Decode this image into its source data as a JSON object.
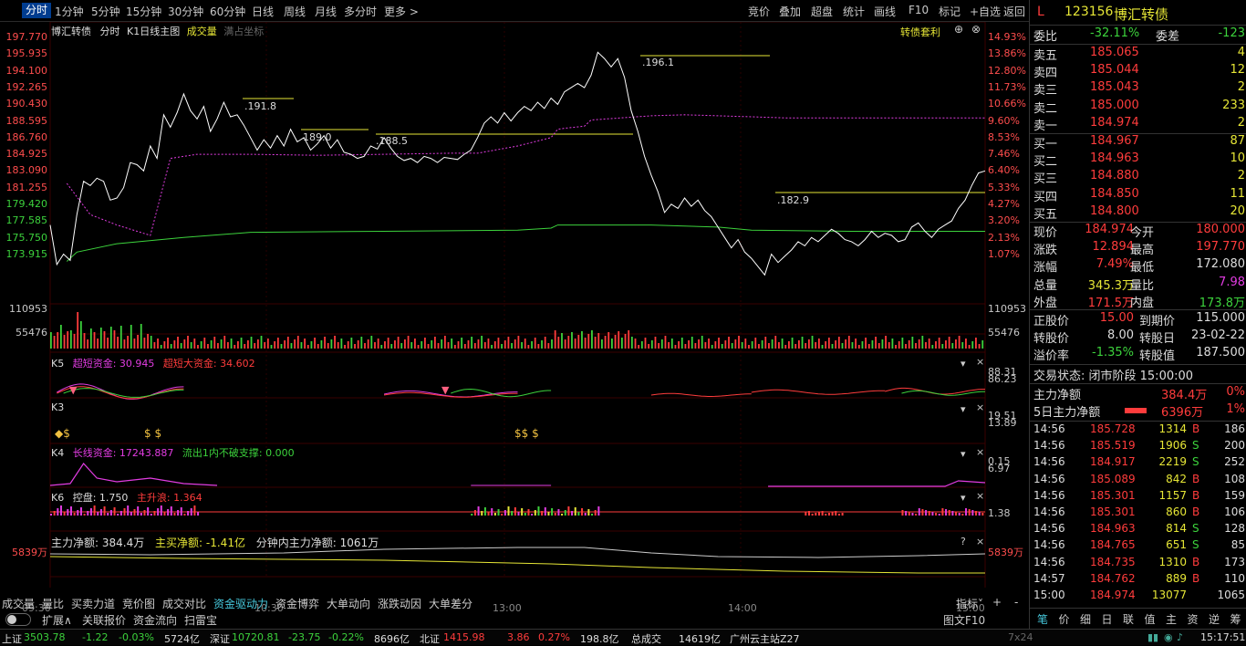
{
  "toolbar": {
    "tabs": [
      "分时",
      "1分钟",
      "5分钟",
      "15分钟",
      "30分钟",
      "60分钟",
      "日线",
      "周线",
      "月线",
      "多分时",
      "更多 >"
    ],
    "right": [
      "竞价",
      "叠加",
      "超盘",
      "统计",
      "画线",
      "F10",
      "标记",
      "+自选",
      "返回"
    ]
  },
  "chart_header": {
    "name": "博汇转债",
    "mode": "分时",
    "k1": "K1日线主图",
    "vol": "成交量",
    "full": "满占坐标",
    "tag": "转债套利"
  },
  "price_axis": [
    "197.770",
    "195.935",
    "194.100",
    "192.265",
    "190.430",
    "188.595",
    "186.760",
    "184.925",
    "183.090",
    "181.255",
    "179.420",
    "177.585",
    "175.750",
    "173.915"
  ],
  "pct_axis": [
    "14.93%",
    "13.86%",
    "12.80%",
    "11.73%",
    "10.66%",
    "9.60%",
    "8.53%",
    "7.46%",
    "6.40%",
    "5.33%",
    "4.27%",
    "3.20%",
    "2.13%",
    "1.07%"
  ],
  "vol_axis": [
    "110953",
    "55476"
  ],
  "annotations": [
    ".191.8",
    "189.0",
    ".188.5",
    ".196.1",
    ".182.9"
  ],
  "k5": {
    "label": "K5",
    "a": "超短资金: 30.945",
    "b": "超短大资金: 34.602",
    "r1": "88.31",
    "r2": "86.23"
  },
  "k3": {
    "label": "K3",
    "r1": "19.51",
    "r2": "13.89"
  },
  "k4": {
    "label": "K4",
    "a": "长线资金: 17243.887",
    "b": "流出1内不破支撑: 0.000",
    "r1": "0.15",
    "r2": "6.97"
  },
  "k6": {
    "label": "K6",
    "a": "控盘: 1.750",
    "b": "主升浪: 1.364",
    "r1": "1.38"
  },
  "flow": {
    "a": "主力净额: 384.4万",
    "b": "主买净额: -1.41亿",
    "c": "分钟内主力净额: 1061万",
    "axis": "5839万"
  },
  "time_axis": [
    "09:30",
    "10:30",
    "13:00",
    "14:00",
    "15:00"
  ],
  "bottom_tabs": [
    "成交量",
    "量比",
    "买卖力道",
    "竞价图",
    "成交对比",
    "资金驱动力",
    "资金博弈",
    "大单动向",
    "涨跌动因",
    "大单差分",
    "扩展∧",
    "关联报价",
    "资金流向",
    "扫雷宝"
  ],
  "bottom_right": {
    "ind": "指标˅",
    "plus": "+",
    "minus": "-",
    "f10": "图文F10"
  },
  "status": {
    "sh_name": "上证",
    "sh_val": "3503.78",
    "sh_chg": "-1.22",
    "sh_pct": "-0.03%",
    "sh_amt": "5724亿",
    "sz_name": "深证",
    "sz_val": "10720.81",
    "sz_chg": "-23.75",
    "sz_pct": "-0.22%",
    "sz_amt": "8696亿",
    "bz_name": "北证",
    "bz_val": "1415.98",
    "bz_chg": "3.86",
    "bz_pct": "0.27%",
    "bz_amt": "198.8亿",
    "tot_name": "总成交",
    "tot_amt": "14619亿",
    "station": "广州云主站Z27",
    "size": "7x24",
    "time": "15:17:51"
  },
  "quote": {
    "flag": "L",
    "code": "123156",
    "name": "博汇转债",
    "wb_label": "委比",
    "wb": "-32.11%",
    "wc_label": "委差",
    "wc": "-123",
    "asks": [
      [
        "卖五",
        "185.065",
        "4"
      ],
      [
        "卖四",
        "185.044",
        "12"
      ],
      [
        "卖三",
        "185.043",
        "2"
      ],
      [
        "卖二",
        "185.000",
        "233"
      ],
      [
        "卖一",
        "184.974",
        "2"
      ]
    ],
    "bids": [
      [
        "买一",
        "184.967",
        "87"
      ],
      [
        "买二",
        "184.963",
        "10"
      ],
      [
        "买三",
        "184.880",
        "2"
      ],
      [
        "买四",
        "184.850",
        "11"
      ],
      [
        "买五",
        "184.800",
        "20"
      ]
    ],
    "stats": [
      [
        "现价",
        "184.974",
        "今开",
        "180.000"
      ],
      [
        "涨跌",
        "12.894",
        "最高",
        "197.770"
      ],
      [
        "涨幅",
        "7.49%",
        "最低",
        "172.080"
      ],
      [
        "总量",
        "345.3万",
        "量比",
        "7.98"
      ],
      [
        "外盘",
        "171.5万",
        "内盘",
        "173.8万"
      ]
    ],
    "extra": [
      [
        "正股价",
        "15.00",
        "到期价",
        "115.000"
      ],
      [
        "转股价",
        "8.00",
        "转股日",
        "23-02-22"
      ],
      [
        "溢价率",
        "-1.35%",
        "转股值",
        "187.500"
      ]
    ],
    "status_label": "交易状态: 闭市阶段 15:00:00",
    "main_net_label": "主力净额",
    "main_net": "384.4万",
    "main_net_pct": "0%",
    "five_net_label": "5日主力净额",
    "five_net": "6396万",
    "five_net_pct": "1%"
  },
  "ticks": [
    [
      "14:56",
      "185.728",
      "1314",
      "B",
      "186"
    ],
    [
      "14:56",
      "185.519",
      "1906",
      "S",
      "200"
    ],
    [
      "14:56",
      "184.917",
      "2219",
      "S",
      "252"
    ],
    [
      "14:56",
      "185.089",
      "842",
      "B",
      "108"
    ],
    [
      "14:56",
      "185.301",
      "1157",
      "B",
      "159"
    ],
    [
      "14:56",
      "185.301",
      "860",
      "B",
      "106"
    ],
    [
      "14:56",
      "184.963",
      "814",
      "S",
      "128"
    ],
    [
      "14:56",
      "184.765",
      "651",
      "S",
      "85"
    ],
    [
      "14:56",
      "184.735",
      "1310",
      "B",
      "173"
    ],
    [
      "14:57",
      "184.762",
      "889",
      "B",
      "110"
    ],
    [
      "15:00",
      "184.974",
      "13077",
      "",
      "1065"
    ]
  ],
  "bottom_nav": [
    "笔",
    "价",
    "细",
    "日",
    "联",
    "值",
    "主",
    "资",
    "逆",
    "筹"
  ],
  "colors": {
    "up": "#ff3c3c",
    "down": "#3cd23c",
    "avg": "#e23ce2",
    "price": "#ffffff",
    "yellow": "#e6e636"
  }
}
